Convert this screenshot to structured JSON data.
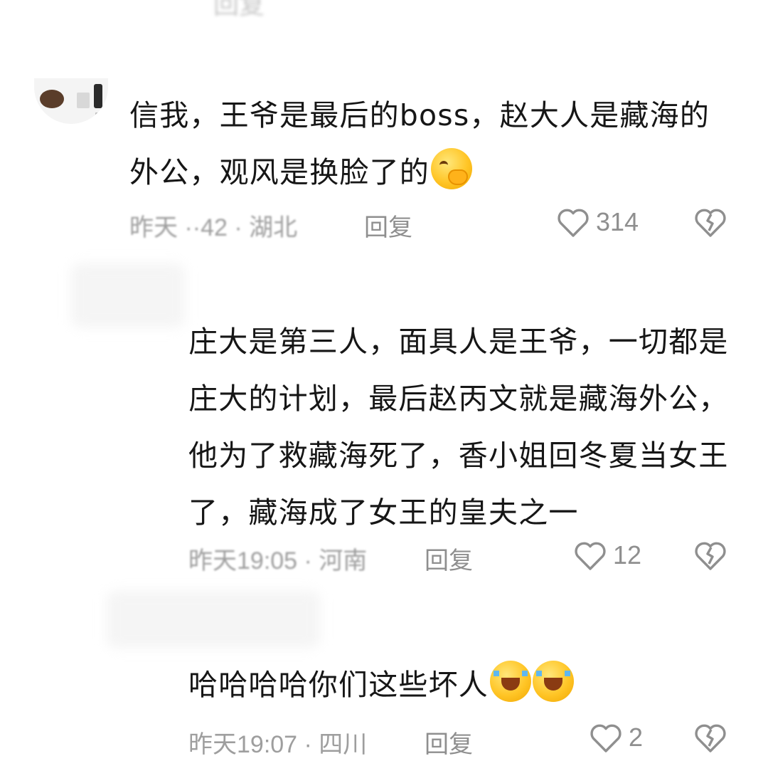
{
  "fragment_top": "回复",
  "comments": [
    {
      "text": "信我，王爷是最后的boss，赵大人是藏海的外公，观风是换脸了的",
      "emoji": "shy-smile-emoji",
      "meta": "昨天 ··42 · 湖北",
      "reply": "回复",
      "likes": "314"
    },
    {
      "text": "庄大是第三人，面具人是王爷，一切都是庄大的计划，最后赵丙文就是藏海外公，他为了救藏海死了，香小姐回冬夏当女王了，藏海成了女王的皇夫之一",
      "meta": "昨天19:05 · 河南",
      "reply": "回复",
      "likes": "12"
    },
    {
      "text": "哈哈哈哈你们这些坏人",
      "emoji": "laugh-cry-emoji",
      "meta": "昨天19:07 · 四川",
      "reply": "回复",
      "likes": "2"
    }
  ],
  "colors": {
    "text": "#161616",
    "meta": "#9e9e9e",
    "icon": "#8f8f8f"
  }
}
